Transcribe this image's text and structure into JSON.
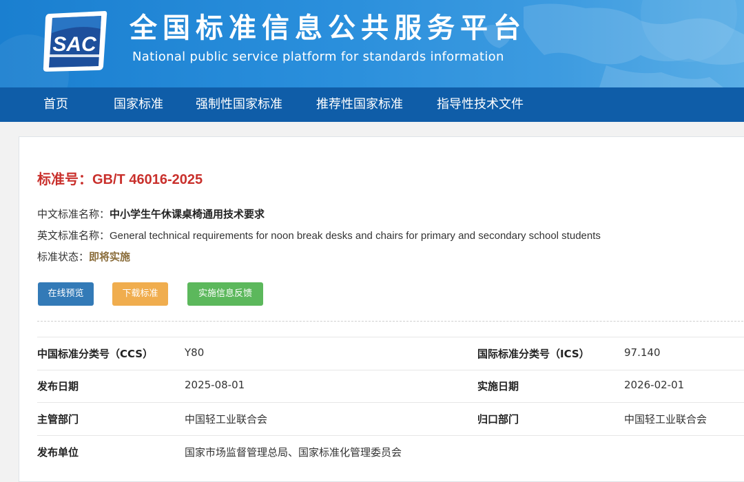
{
  "header": {
    "logo_text": "SAC",
    "title": "全国标准信息公共服务平台",
    "subtitle": "National public service platform  for standards information"
  },
  "nav": {
    "items": [
      "首页",
      "国家标准",
      "强制性国家标准",
      "推荐性国家标准",
      "指导性技术文件"
    ]
  },
  "standard": {
    "number_label": "标准号：",
    "number": "GB/T 46016-2025",
    "cn_name_label": "中文标准名称：",
    "cn_name": "中小学生午休课桌椅通用技术要求",
    "en_name_label": "英文标准名称：",
    "en_name": "General technical requirements for noon break desks and chairs for primary and secondary school students",
    "status_label": "标准状态：",
    "status": "即将实施",
    "status_color": "#8a6d3b"
  },
  "actions": {
    "preview": "在线预览",
    "download": "下载标准",
    "feedback": "实施信息反馈"
  },
  "details": {
    "rows": [
      {
        "k1": "中国标准分类号（CCS）",
        "v1": "Y80",
        "k2": "国际标准分类号（ICS）",
        "v2": "97.140"
      },
      {
        "k1": "发布日期",
        "v1": "2025-08-01",
        "k2": "实施日期",
        "v2": "2026-02-01"
      },
      {
        "k1": "主管部门",
        "v1": "中国轻工业联合会",
        "k2": "归口部门",
        "v2": "中国轻工业联合会"
      },
      {
        "k1": "发布单位",
        "v1": "国家市场监督管理总局、国家标准化管理委员会",
        "k2": "",
        "v2": ""
      }
    ]
  },
  "colors": {
    "header_blue": "#1a7fd0",
    "nav_blue": "#0f5da8",
    "title_red": "#c9302c",
    "btn_blue": "#337ab7",
    "btn_orange": "#f0ad4e",
    "btn_green": "#5cb85c"
  }
}
